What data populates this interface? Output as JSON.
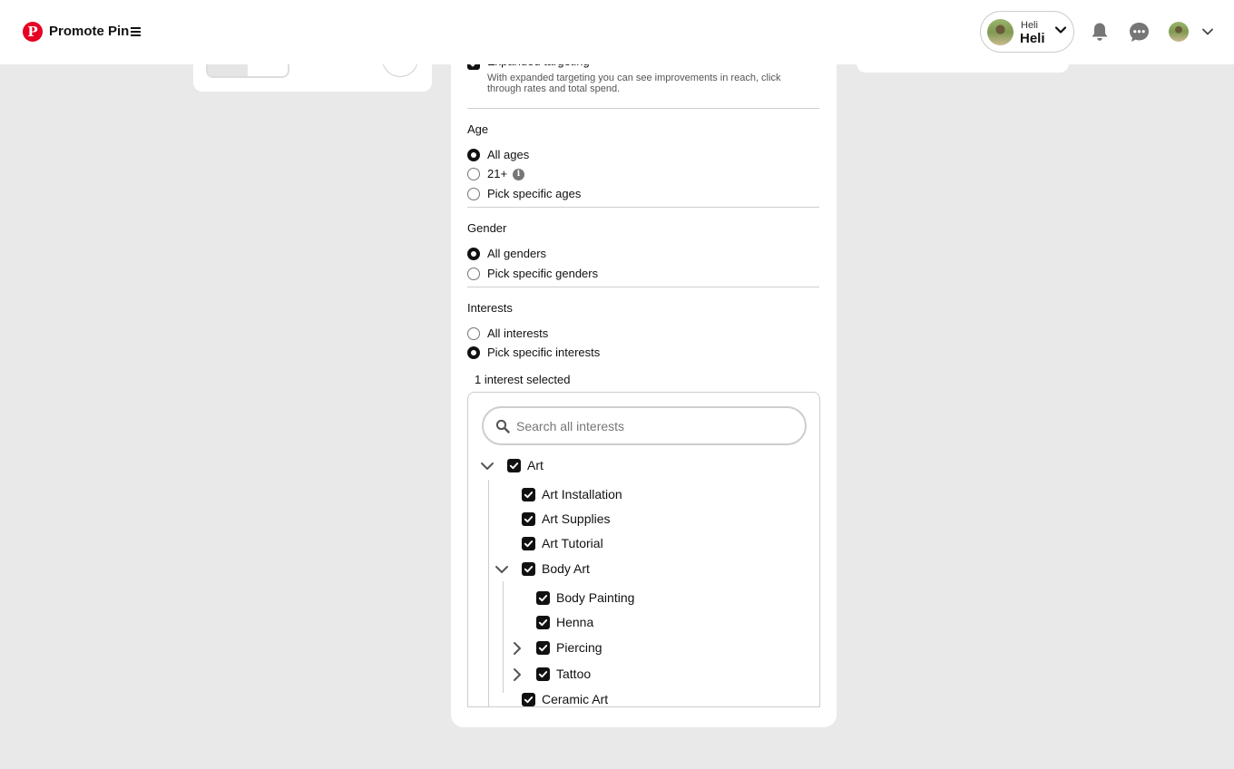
{
  "header": {
    "logo": "P",
    "title": "Promote Pin",
    "account": {
      "small": "Heli",
      "big": "Heli"
    }
  },
  "panel": {
    "expanded": {
      "label": "Expanded targeting",
      "description": "With expanded targeting you can see improvements in reach, click through rates and total spend."
    },
    "age": {
      "title": "Age",
      "options": [
        {
          "label": "All ages",
          "selected": true
        },
        {
          "label": "21+",
          "selected": false,
          "info": "i"
        },
        {
          "label": "Pick specific ages",
          "selected": false
        }
      ]
    },
    "gender": {
      "title": "Gender",
      "options": [
        {
          "label": "All genders",
          "selected": true
        },
        {
          "label": "Pick specific genders",
          "selected": false
        }
      ]
    },
    "interests": {
      "title": "Interests",
      "options": [
        {
          "label": "All interests",
          "selected": false
        },
        {
          "label": "Pick specific interests",
          "selected": true
        }
      ],
      "count_text": "1 interest selected",
      "search_placeholder": "Search all interests",
      "tree": [
        {
          "label": "Art",
          "checked": true,
          "expanded": true
        },
        {
          "label": "Art Installation",
          "checked": true
        },
        {
          "label": "Art Supplies",
          "checked": true
        },
        {
          "label": "Art Tutorial",
          "checked": true
        },
        {
          "label": "Body Art",
          "checked": true,
          "expanded": true
        },
        {
          "label": "Body Painting",
          "checked": true
        },
        {
          "label": "Henna",
          "checked": true
        },
        {
          "label": "Piercing",
          "checked": true,
          "expanded": false
        },
        {
          "label": "Tattoo",
          "checked": true,
          "expanded": false
        },
        {
          "label": "Ceramic Art",
          "checked": true
        }
      ]
    }
  },
  "colors": {
    "brand": "#e60023",
    "checked": "#111111",
    "background": "#e9e9e9"
  }
}
